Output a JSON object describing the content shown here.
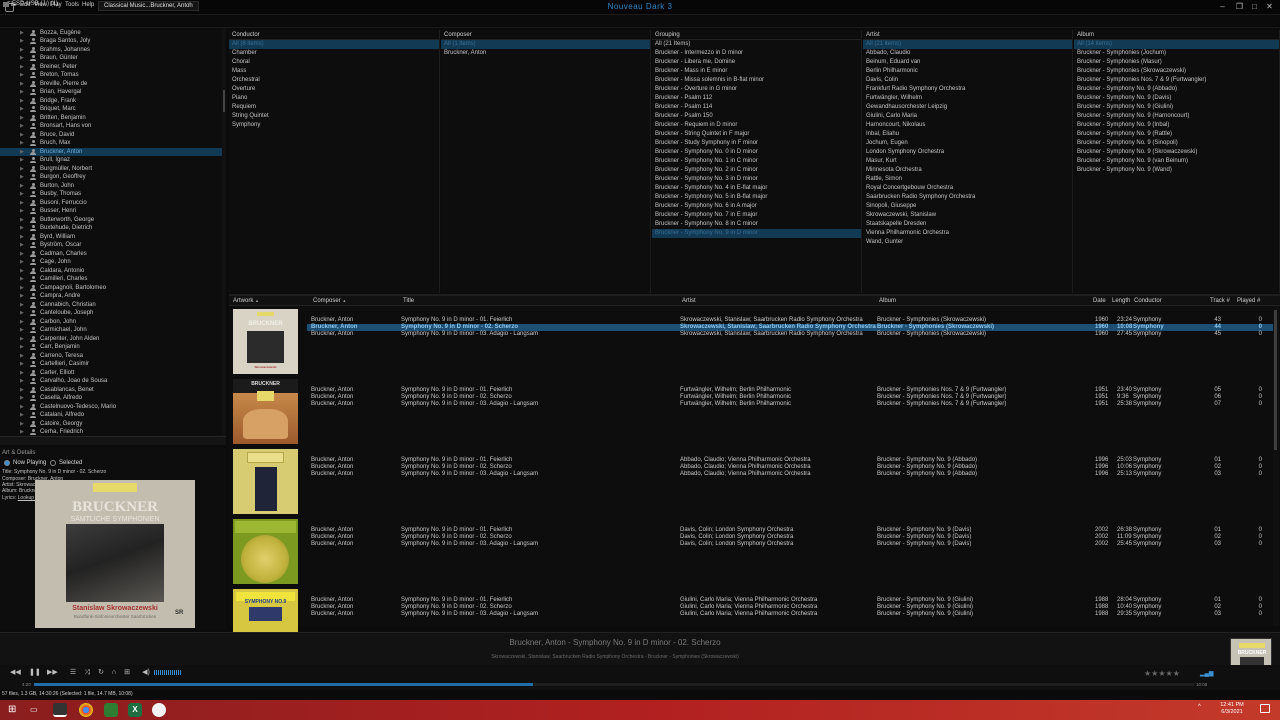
{
  "window": {
    "title": "Nouveau Dark 3"
  },
  "menu": [
    "File",
    "Edit",
    "View",
    "Play",
    "Tools",
    "Help"
  ],
  "tab": {
    "label": "Classical Music...Bruckner, Anton",
    "add": "+"
  },
  "tree": {
    "items": [
      "Bozza, Eugène",
      "Braga Santos, Joly",
      "Brahms, Johannes",
      "Braun, Günter",
      "Breiner, Peter",
      "Breton, Tomas",
      "Breville, Pierre de",
      "Brian, Havergal",
      "Bridge, Frank",
      "Briquet, Marc",
      "Britten, Benjamin",
      "Bronsart, Hans von",
      "Bruce, David",
      "Bruch, Max",
      "Bruckner, Anton",
      "Brull, Ignaz",
      "Burgmüller, Norbert",
      "Burgon, Geoffrey",
      "Burton, John",
      "Busby, Thomas",
      "Busoni, Ferruccio",
      "Busser, Henri",
      "Butterworth, George",
      "Buxtehude, Dietrich",
      "Byrd, William",
      "Byström, Oscar",
      "Cadman, Charles",
      "Cage, John",
      "Caldara, Antonio",
      "Camilleri, Charles",
      "Campagnoli, Bartolomeo",
      "Campra, Andre",
      "Cannabich, Christian",
      "Canteloube, Joseph",
      "Carbon, John",
      "Carmichael, John",
      "Carpenter, John Alden",
      "Carr, Benjamin",
      "Carreno, Teresa",
      "Cartellieri, Casimir",
      "Carter, Elliott",
      "Carvalho, Joao de Sousa",
      "Casablancas, Benet",
      "Casella, Alfredo",
      "Castelnuovo-Tedesco, Mario",
      "Catalani, Alfredo",
      "Catoire, Georgy",
      "Cerha, Friedrich"
    ],
    "selected_index": 14,
    "drive": "ESD-USB (J:) (1)"
  },
  "art_details": {
    "header": "Art & Details",
    "now_playing": "Now Playing",
    "selected": "Selected",
    "lines": [
      "Title: Symphony No. 9 in D minor - 02. Scherzo",
      "Composer: Bruckner, Anton",
      "Artist: Skrowaczewski, Stanislaw; Saarbrucken Radio Symphony Orchestra",
      "Album: Bruckner - Symphonies (Skrowaczewski)"
    ],
    "lyrics_prefix": "Lyrics: ",
    "lyrics_link": "Lookup lyrics",
    "cover": {
      "title": "BRUCKNER",
      "subtitle": "SÄMTLICHE SYMPHONIEN",
      "artist": "Stanislaw Skrowaczewski",
      "orchestra": "Rundfunk-Sinfonieorchester Saarbrücken",
      "badge": "SR"
    }
  },
  "panes": [
    {
      "name": "conductor",
      "header": "Conductor",
      "items": [
        "All (8 items)",
        "Chamber",
        "Choral",
        "Mass",
        "Orchestral",
        "Overture",
        "Piano",
        "Requiem",
        "String Quintet",
        "Symphony"
      ],
      "selected": 0
    },
    {
      "name": "composer",
      "header": "Composer",
      "items": [
        "All (1 items)",
        "Bruckner, Anton"
      ],
      "selected": 0
    },
    {
      "name": "grouping",
      "header": "Grouping",
      "items": [
        "All (21 Items)",
        "Bruckner - Intermezzo in D minor",
        "Bruckner - Libera me, Domine",
        "Bruckner - Mass in E minor",
        "Bruckner - Missa solemnis in B-flat minor",
        "Bruckner - Overture in G minor",
        "Bruckner - Psalm 112",
        "Bruckner - Psalm 114",
        "Bruckner - Psalm 150",
        "Bruckner - Requiem in D minor",
        "Bruckner - String Quintet in F major",
        "Bruckner - Study Symphony in F minor",
        "Bruckner - Symphony No. 0 in D minor",
        "Bruckner - Symphony No. 1 in C minor",
        "Bruckner - Symphony No. 2 in C minor",
        "Bruckner - Symphony No. 3 in D minor",
        "Bruckner - Symphony No. 4 in E-flat major",
        "Bruckner - Symphony No. 5 in B-flat major",
        "Bruckner - Symphony No. 6 in A major",
        "Bruckner - Symphony No. 7 in E major",
        "Bruckner - Symphony No. 8 in C minor",
        "Bruckner - Symphony No. 9 in D minor"
      ],
      "selected": 21
    },
    {
      "name": "artist",
      "header": "Artist",
      "items": [
        "All (21 items)",
        "Abbado, Claudio",
        "Beinum, Eduard van",
        "Berlin Philharmonic",
        "Davis, Colin",
        "Frankfurt Radio Symphony Orchestra",
        "Furtwängler, Wilhelm",
        "Gewandhausorchester Leipzig",
        "Giulini, Carlo Maria",
        "Harnoncourt, Nikolaus",
        "Inbal, Eliahu",
        "Jochum, Eugen",
        "London Symphony Orchestra",
        "Masur, Kurt",
        "Minnesota Orchestra",
        "Rattle, Simon",
        "Royal Concertgebouw Orchestra",
        "Saarbrucken Radio Symphony Orchestra",
        "Sinopoli, Giuseppe",
        "Skrowaczewski, Stanislaw",
        "Staatskapelle Dresden",
        "Vienna Philharmonic Orchestra",
        "Wand, Gunter"
      ],
      "selected": 0
    },
    {
      "name": "album",
      "header": "Album",
      "items": [
        "All (14 items)",
        "Bruckner - Symphonies (Jochum)",
        "Bruckner - Symphonies (Masur)",
        "Bruckner - Symphonies (Skrowaczewski)",
        "Bruckner - Symphonies Nos. 7 & 9 (Furtwangler)",
        "Bruckner - Symphony No. 9 (Abbado)",
        "Bruckner - Symphony No. 9 (Davis)",
        "Bruckner - Symphony No. 9 (Giulini)",
        "Bruckner - Symphony No. 9 (Harnoncourt)",
        "Bruckner - Symphony No. 9 (Inbal)",
        "Bruckner - Symphony No. 9 (Rattle)",
        "Bruckner - Symphony No. 9 (Sinopoli)",
        "Bruckner - Symphony No. 9 (Skrowaczewski)",
        "Bruckner - Symphony No. 9 (van Beinum)",
        "Bruckner - Symphony No. 9 (Wand)"
      ],
      "selected": 0
    }
  ],
  "tracklist": {
    "headers": {
      "artwork": "Artwork",
      "composer": "Composer",
      "title": "Title",
      "artist": "Artist",
      "album": "Album",
      "date": "Date",
      "length": "Length",
      "conductor": "Conductor",
      "track": "Track #",
      "played": "Played #"
    },
    "groups": [
      {
        "art": "skrowaczewski",
        "tracks": [
          {
            "composer": "Bruckner, Anton",
            "title": "Symphony No. 9 in D minor - 01. Feierlich",
            "artist": "Skrowaczewski, Stanislaw; Saarbrucken Radio Symphony Orchestra",
            "album": "Bruckner - Symphonies (Skrowaczewski)",
            "date": "1960",
            "length": "23:24",
            "conductor": "Symphony",
            "track": "43",
            "played": "0"
          },
          {
            "composer": "Bruckner, Anton",
            "title": "Symphony No. 9 in D minor - 02. Scherzo",
            "artist": "Skrowaczewski, Stanislaw; Saarbrucken Radio Symphony Orchestra",
            "album": "Bruckner - Symphonies (Skrowaczewski)",
            "date": "1960",
            "length": "10:08",
            "conductor": "Symphony",
            "track": "44",
            "played": "0",
            "playing": true
          },
          {
            "composer": "Bruckner, Anton",
            "title": "Symphony No. 9 in D minor - 03. Adagio - Langsam",
            "artist": "Skrowaczewski, Stanislaw; Saarbrucken Radio Symphony Orchestra",
            "album": "Bruckner - Symphonies (Skrowaczewski)",
            "date": "1960",
            "length": "27:45",
            "conductor": "Symphony",
            "track": "45",
            "played": "0"
          }
        ]
      },
      {
        "art": "furtwangler",
        "tracks": [
          {
            "composer": "Bruckner, Anton",
            "title": "Symphony No. 9 in D minor - 01. Feierlich",
            "artist": "Furtwängler, Wilhelm; Berlin Philharmonic",
            "album": "Bruckner - Symphonies Nos. 7 & 9 (Furtwangler)",
            "date": "1951",
            "length": "23:40",
            "conductor": "Symphony",
            "track": "05",
            "played": "0"
          },
          {
            "composer": "Bruckner, Anton",
            "title": "Symphony No. 9 in D minor - 02. Scherzo",
            "artist": "Furtwängler, Wilhelm; Berlin Philharmonic",
            "album": "Bruckner - Symphonies Nos. 7 & 9 (Furtwangler)",
            "date": "1951",
            "length": "9:36",
            "conductor": "Symphony",
            "track": "06",
            "played": "0"
          },
          {
            "composer": "Bruckner, Anton",
            "title": "Symphony No. 9 in D minor - 03. Adagio - Langsam",
            "artist": "Furtwängler, Wilhelm; Berlin Philharmonic",
            "album": "Bruckner - Symphonies Nos. 7 & 9 (Furtwangler)",
            "date": "1951",
            "length": "25:38",
            "conductor": "Symphony",
            "track": "07",
            "played": "0"
          }
        ]
      },
      {
        "art": "abbado",
        "tracks": [
          {
            "composer": "Bruckner, Anton",
            "title": "Symphony No. 9 in D minor - 01. Feierlich",
            "artist": "Abbado, Claudio; Vienna Philharmonic Orchestra",
            "album": "Bruckner - Symphony No. 9 (Abbado)",
            "date": "1996",
            "length": "25:03",
            "conductor": "Symphony",
            "track": "01",
            "played": "0"
          },
          {
            "composer": "Bruckner, Anton",
            "title": "Symphony No. 9 in D minor - 02. Scherzo",
            "artist": "Abbado, Claudio; Vienna Philharmonic Orchestra",
            "album": "Bruckner - Symphony No. 9 (Abbado)",
            "date": "1996",
            "length": "10:06",
            "conductor": "Symphony",
            "track": "02",
            "played": "0"
          },
          {
            "composer": "Bruckner, Anton",
            "title": "Symphony No. 9 in D minor - 03. Adagio - Langsam",
            "artist": "Abbado, Claudio; Vienna Philharmonic Orchestra",
            "album": "Bruckner - Symphony No. 9 (Abbado)",
            "date": "1996",
            "length": "25:13",
            "conductor": "Symphony",
            "track": "03",
            "played": "0"
          }
        ]
      },
      {
        "art": "davis",
        "tracks": [
          {
            "composer": "Bruckner, Anton",
            "title": "Symphony No. 9 in D minor - 01. Feierlich",
            "artist": "Davis, Colin; London Symphony Orchestra",
            "album": "Bruckner - Symphony No. 9 (Davis)",
            "date": "2002",
            "length": "26:38",
            "conductor": "Symphony",
            "track": "01",
            "played": "0"
          },
          {
            "composer": "Bruckner, Anton",
            "title": "Symphony No. 9 in D minor - 02. Scherzo",
            "artist": "Davis, Colin; London Symphony Orchestra",
            "album": "Bruckner - Symphony No. 9 (Davis)",
            "date": "2002",
            "length": "11:09",
            "conductor": "Symphony",
            "track": "02",
            "played": "0"
          },
          {
            "composer": "Bruckner, Anton",
            "title": "Symphony No. 9 in D minor - 03. Adagio - Langsam",
            "artist": "Davis, Colin; London Symphony Orchestra",
            "album": "Bruckner - Symphony No. 9 (Davis)",
            "date": "2002",
            "length": "25:45",
            "conductor": "Symphony",
            "track": "03",
            "played": "0"
          }
        ]
      },
      {
        "art": "giulini",
        "tracks": [
          {
            "composer": "Bruckner, Anton",
            "title": "Symphony No. 9 in D minor - 01. Feierlich",
            "artist": "Giulini, Carlo Maria; Vienna Philharmonic Orchestra",
            "album": "Bruckner - Symphony No. 9 (Giulini)",
            "date": "1988",
            "length": "28:04",
            "conductor": "Symphony",
            "track": "01",
            "played": "0"
          },
          {
            "composer": "Bruckner, Anton",
            "title": "Symphony No. 9 in D minor - 02. Scherzo",
            "artist": "Giulini, Carlo Maria; Vienna Philharmonic Orchestra",
            "album": "Bruckner - Symphony No. 9 (Giulini)",
            "date": "1988",
            "length": "10:40",
            "conductor": "Symphony",
            "track": "02",
            "played": "0"
          },
          {
            "composer": "Bruckner, Anton",
            "title": "Symphony No. 9 in D minor - 03. Adagio - Langsam",
            "artist": "Giulini, Carlo Maria; Vienna Philharmonic Orchestra",
            "album": "Bruckner - Symphony No. 9 (Giulini)",
            "date": "1988",
            "length": "29:35",
            "conductor": "Symphony",
            "track": "03",
            "played": "0"
          }
        ]
      }
    ]
  },
  "now_playing": {
    "title": "Bruckner, Anton - Symphony No. 9 in D minor - 02. Scherzo",
    "subtitle": "Skrowaczewski, Stanislaw; Saarbrucken Radio Symphony Orchestra - Bruckner - Symphonies (Skrowaczewski)",
    "position": "4:20",
    "length": "10:08",
    "progress": 0.43
  },
  "status": "57 files, 1.3 GB, 14:30:26 (Selected: 1 file, 14.7 MB, 10:08)",
  "taskbar": {
    "time": "12:41 PM",
    "date": "6/3/2021"
  },
  "icons": [
    "minimize-icon",
    "restore-icon",
    "maximize-icon",
    "close-icon",
    "prev-icon",
    "pause-icon",
    "next-icon",
    "playlist-icon",
    "shuffle-icon",
    "repeat-icon",
    "volume-icon",
    "star-icon"
  ]
}
